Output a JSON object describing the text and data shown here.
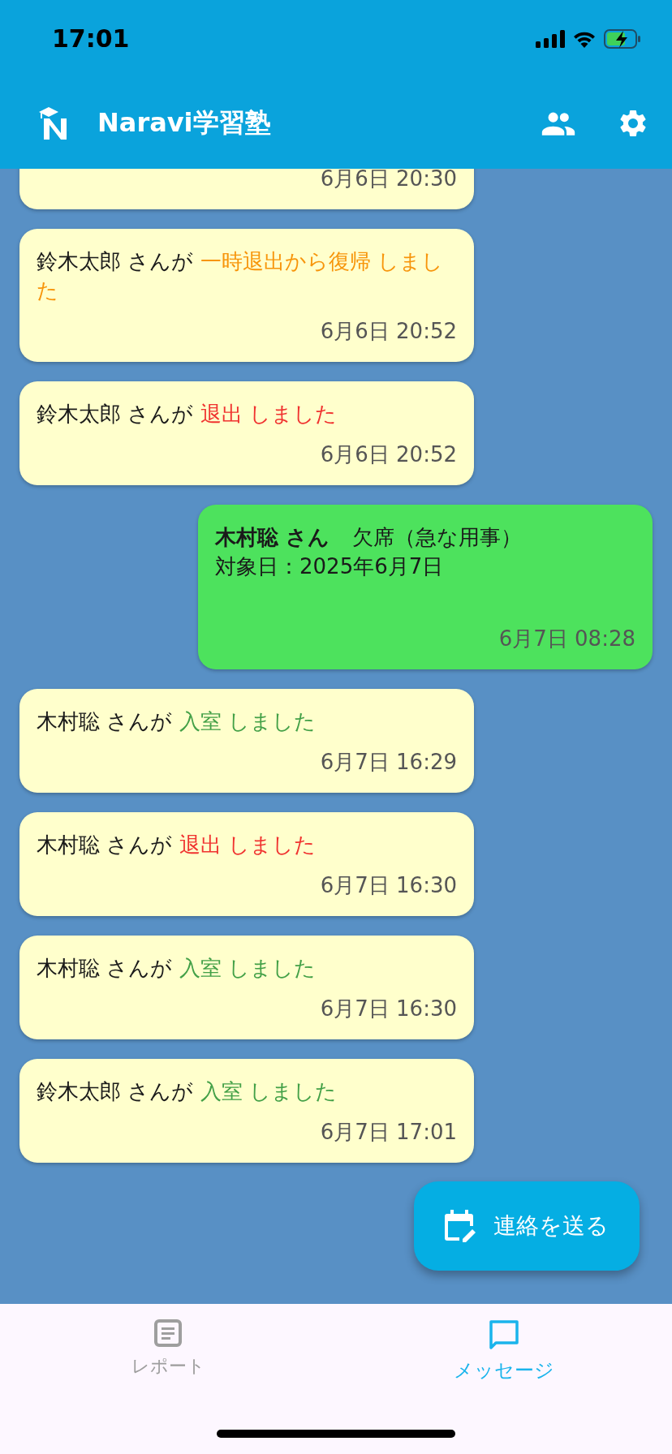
{
  "status_bar": {
    "time": "17:01"
  },
  "app_bar": {
    "title": "Naravi学習塾"
  },
  "messages": [
    {
      "kind": "event",
      "time": "6月6日 20:30"
    },
    {
      "kind": "event",
      "name": "鈴木太郎 さんが",
      "action": "一時退出から復帰 しました",
      "color": "#f7950b",
      "time": "6月6日 20:52"
    },
    {
      "kind": "event",
      "name": "鈴木太郎 さんが",
      "action": "退出 しました",
      "color": "#f0322f",
      "time": "6月6日 20:52"
    },
    {
      "kind": "absence",
      "name": "木村聡 さん",
      "reason": "欠席（急な用事）",
      "date": "対象日：2025年6月7日",
      "time": "6月7日 08:28"
    },
    {
      "kind": "event",
      "name": "木村聡 さんが",
      "action": "入室 しました",
      "color": "#43a047",
      "time": "6月7日 16:29"
    },
    {
      "kind": "event",
      "name": "木村聡 さんが",
      "action": "退出 しました",
      "color": "#f0322f",
      "time": "6月7日 16:30"
    },
    {
      "kind": "event",
      "name": "木村聡 さんが",
      "action": "入室 しました",
      "color": "#43a047",
      "time": "6月7日 16:30"
    },
    {
      "kind": "event",
      "name": "鈴木太郎 さんが",
      "action": "入室 しました",
      "color": "#43a047",
      "time": "6月7日 17:01"
    }
  ],
  "fab": {
    "label": "連絡を送る"
  },
  "bottom_nav": [
    {
      "label": "レポート",
      "selected": false
    },
    {
      "label": "メッセージ",
      "selected": true
    }
  ]
}
